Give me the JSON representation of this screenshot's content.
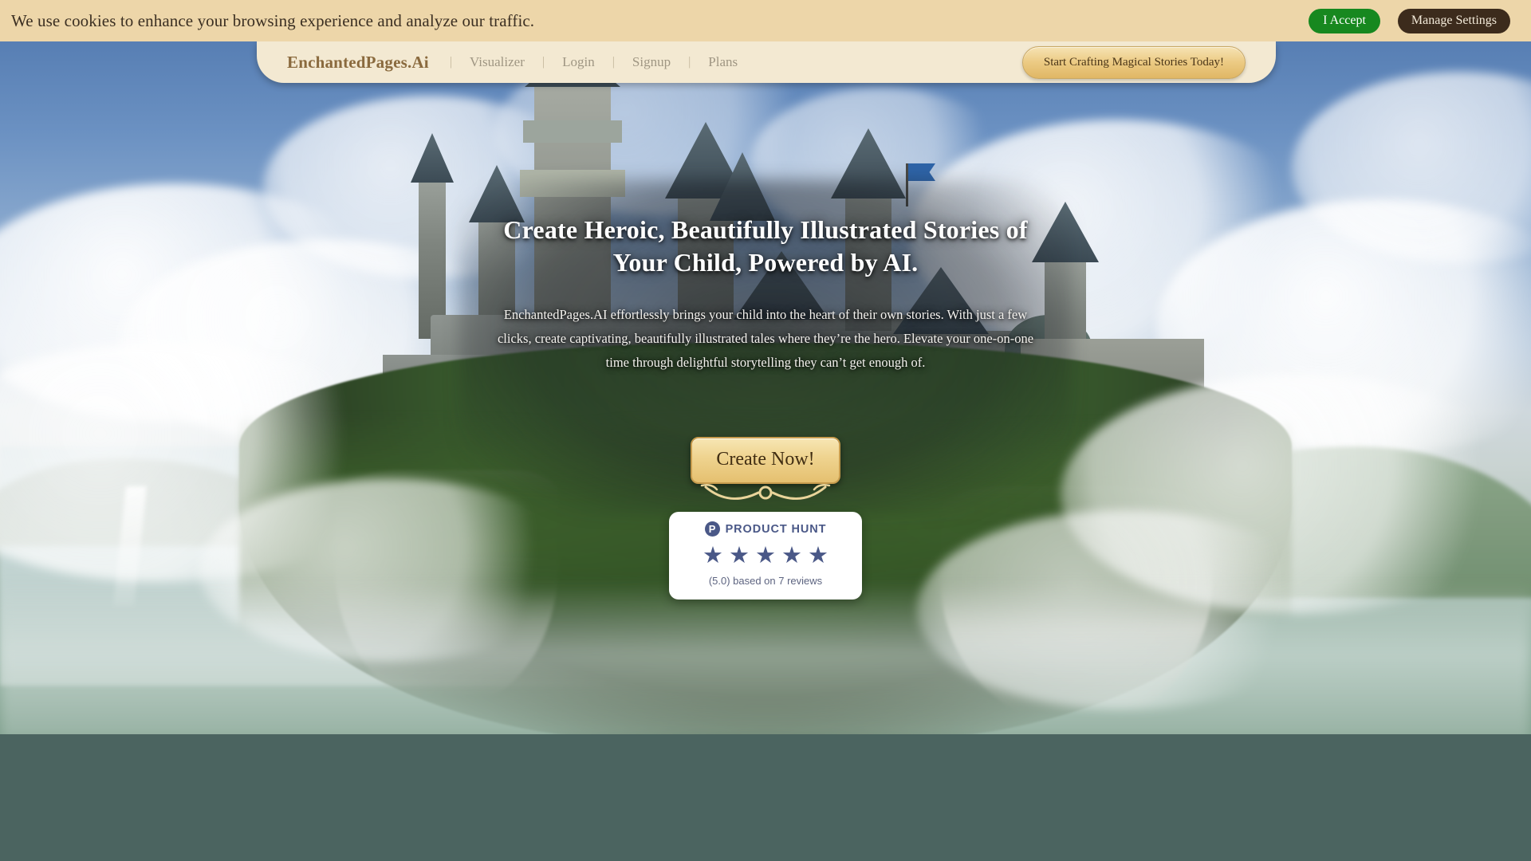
{
  "cookie_banner": {
    "message": "We use cookies to enhance your browsing experience and analyze our traffic.",
    "accept_label": "I Accept",
    "manage_label": "Manage Settings",
    "background_color": "#edd6a9",
    "accept_color": "#17881f",
    "manage_color": "#3c2b1c"
  },
  "nav": {
    "brand": "EnchantedPages.Ai",
    "separator": "|",
    "links": [
      {
        "label": "Visualizer"
      },
      {
        "label": "Login"
      },
      {
        "label": "Signup"
      },
      {
        "label": "Plans"
      }
    ],
    "cta_label": "Start Crafting Magical Stories Today!",
    "background_color": "#f3e9d2",
    "brand_color": "#8a6a3e"
  },
  "hero": {
    "headline": "Create Heroic, Beautifully Illustrated Stories of Your Child, Powered by AI.",
    "subcopy": "EnchantedPages.AI effortlessly brings your child into the heart of their own stories. With just a few clicks, create captivating, beautifully illustrated tales where they’re the hero. Elevate your one-on-one time through delightful storytelling they can’t get enough of.",
    "cta_label": "Create Now!",
    "cta_color": "#efd490"
  },
  "product_hunt": {
    "logo_letter": "P",
    "title": "PRODUCT HUNT",
    "stars": [
      "★",
      "★",
      "★",
      "★",
      "★"
    ],
    "rating_text": "(5.0) based on 7 reviews",
    "brand_color": "#4a5887"
  },
  "theme": {
    "below_section_color": "#4b6460"
  }
}
